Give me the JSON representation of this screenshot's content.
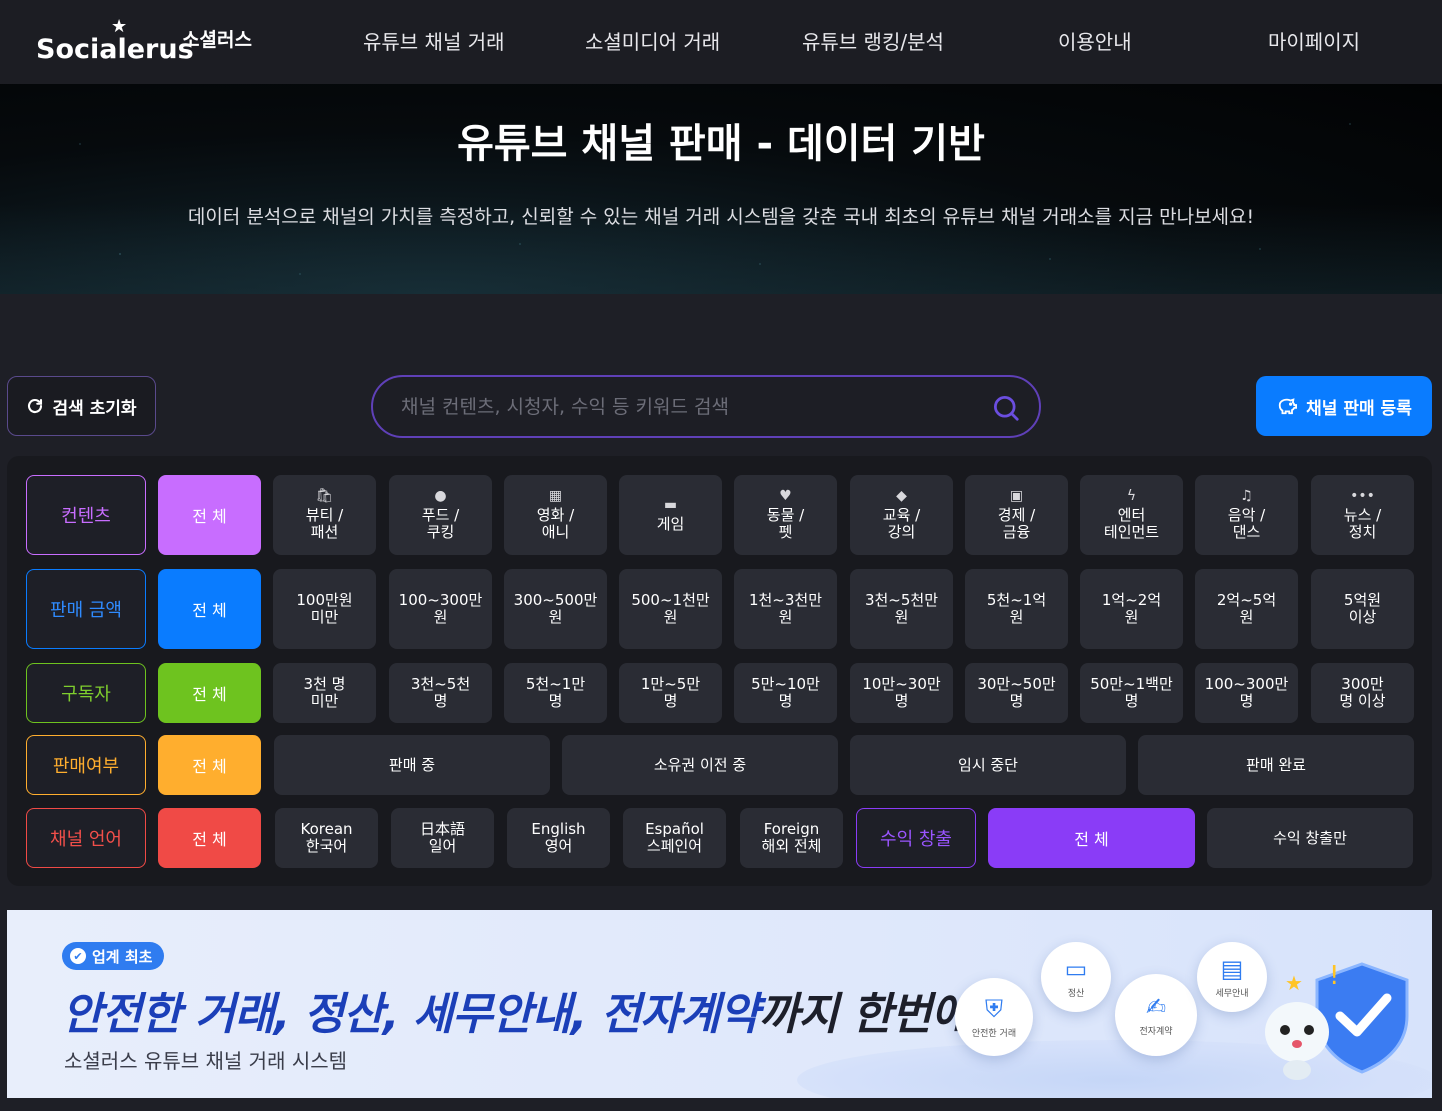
{
  "nav": {
    "logo": "Socialerus",
    "logo_sub": "소셜러스",
    "items": [
      "유튜브 채널 거래",
      "소셜미디어 거래",
      "유튜브 랭킹/분석",
      "이용안내",
      "마이페이지"
    ]
  },
  "hero": {
    "title": "유튜브 채널 판매 - 데이터 기반",
    "description": "데이터 분석으로 채널의 가치를 측정하고, 신뢰할 수 있는 채널 거래 시스템을 갖춘 국내 최초의 유튜브 채널 거래소를 지금 만나보세요!"
  },
  "actions": {
    "reset_label": "검색 초기화",
    "search_placeholder": "채널 컨텐츠, 시청자, 수익 등 키워드 검색",
    "register_label": "채널 판매 등록"
  },
  "filters": {
    "content": {
      "label": "컨텐츠",
      "all": "전 체",
      "options": [
        {
          "l1": "뷰티 /",
          "l2": "패션",
          "icon": "bag-icon"
        },
        {
          "l1": "푸드 /",
          "l2": "쿠킹",
          "icon": "cookie-icon"
        },
        {
          "l1": "영화 /",
          "l2": "애니",
          "icon": "film-icon"
        },
        {
          "l1": "게임",
          "l2": "",
          "icon": "gamepad-icon"
        },
        {
          "l1": "동물 /",
          "l2": "펫",
          "icon": "heart-icon"
        },
        {
          "l1": "교육 /",
          "l2": "강의",
          "icon": "graduation-cap-icon"
        },
        {
          "l1": "경제 /",
          "l2": "금융",
          "icon": "money-icon"
        },
        {
          "l1": "엔터",
          "l2": "테인먼트",
          "icon": "bolt-icon"
        },
        {
          "l1": "음악 /",
          "l2": "댄스",
          "icon": "music-icon"
        },
        {
          "l1": "뉴스 /",
          "l2": "정치",
          "icon": "dots-icon"
        }
      ]
    },
    "price": {
      "label": "판매 금액",
      "all": "전 체",
      "options": [
        {
          "l1": "100만원",
          "l2": "미만"
        },
        {
          "l1": "100~300만",
          "l2": "원"
        },
        {
          "l1": "300~500만",
          "l2": "원"
        },
        {
          "l1": "500~1천만",
          "l2": "원"
        },
        {
          "l1": "1천~3천만",
          "l2": "원"
        },
        {
          "l1": "3천~5천만",
          "l2": "원"
        },
        {
          "l1": "5천~1억",
          "l2": "원"
        },
        {
          "l1": "1억~2억",
          "l2": "원"
        },
        {
          "l1": "2억~5억",
          "l2": "원"
        },
        {
          "l1": "5억원",
          "l2": "이상"
        }
      ]
    },
    "subscribers": {
      "label": "구독자",
      "all": "전 체",
      "options": [
        {
          "l1": "3천 명",
          "l2": "미만"
        },
        {
          "l1": "3천~5천",
          "l2": "명"
        },
        {
          "l1": "5천~1만",
          "l2": "명"
        },
        {
          "l1": "1만~5만",
          "l2": "명"
        },
        {
          "l1": "5만~10만",
          "l2": "명"
        },
        {
          "l1": "10만~30만",
          "l2": "명"
        },
        {
          "l1": "30만~50만",
          "l2": "명"
        },
        {
          "l1": "50만~1백만",
          "l2": "명"
        },
        {
          "l1": "100~300만",
          "l2": "명"
        },
        {
          "l1": "300만",
          "l2": "명 이상"
        }
      ]
    },
    "status": {
      "label": "판매여부",
      "all": "전 체",
      "options": [
        "판매 중",
        "소유권 이전 중",
        "임시 중단",
        "판매 완료"
      ]
    },
    "language": {
      "label": "채널 언어",
      "all": "전 체",
      "options": [
        {
          "l1": "Korean",
          "l2": "한국어"
        },
        {
          "l1": "日本語",
          "l2": "일어"
        },
        {
          "l1": "English",
          "l2": "영어"
        },
        {
          "l1": "Español",
          "l2": "스페인어"
        },
        {
          "l1": "Foreign",
          "l2": "해외 전체"
        }
      ]
    },
    "monetization": {
      "label": "수익 창출",
      "all": "전 체",
      "only": "수익 창출만"
    }
  },
  "colors": {
    "content": "#c86dff",
    "price": "#0a7cff",
    "subscribers": "#6ec31f",
    "status": "#ffae2e",
    "language": "#f04a46",
    "monetization": "#8a3cf7"
  },
  "banner": {
    "badge": "업계 최초",
    "headline_blue": "안전한 거래, 정산, 세무안내, 전자계약",
    "headline_dark": "까지 한번에!",
    "subtitle": "소셜러스 유튜브 채널 거래 시스템",
    "bubbles": [
      "안전한 거래",
      "정산",
      "전자계약",
      "세무안내"
    ]
  }
}
